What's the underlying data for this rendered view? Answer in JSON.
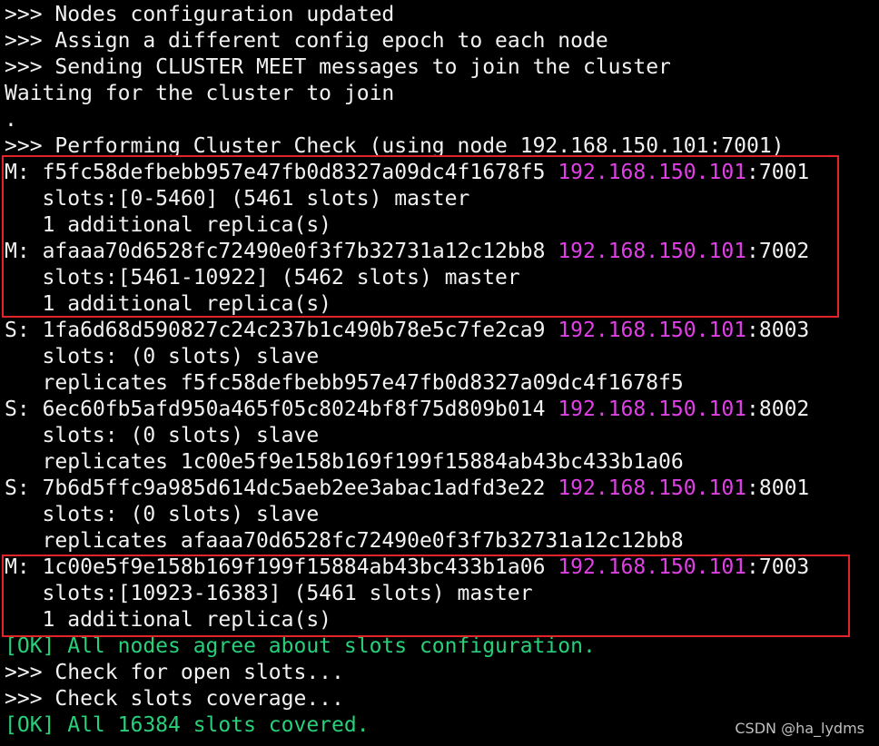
{
  "colors": {
    "background": "#000000",
    "text": "#f2f2f2",
    "ip_address": "#e040e6",
    "ok_message": "#28d07a",
    "highlight_border": "#e0242a"
  },
  "terminal": {
    "lines": [
      ">>> Nodes configuration updated",
      ">>> Assign a different config epoch to each node",
      ">>> Sending CLUSTER MEET messages to join the cluster",
      "Waiting for the cluster to join",
      ".",
      ">>> Performing Cluster Check (using node 192.168.150.101:7001)"
    ],
    "nodes": [
      {
        "role": "M:",
        "id": "f5fc58defbebb957e47fb0d8327a09dc4f1678f5",
        "ip": "192.168.150.101",
        "port": ":7001",
        "slots": "slots:[0-5460] (5461 slots) master",
        "extra": "1 additional replica(s)"
      },
      {
        "role": "M:",
        "id": "afaaa70d6528fc72490e0f3f7b32731a12c12bb8",
        "ip": "192.168.150.101",
        "port": ":7002",
        "slots": "slots:[5461-10922] (5462 slots) master",
        "extra": "1 additional replica(s)"
      },
      {
        "role": "S:",
        "id": "1fa6d68d590827c24c237b1c490b78e5c7fe2ca9",
        "ip": "192.168.150.101",
        "port": ":8003",
        "slots": "slots: (0 slots) slave",
        "extra": "replicates f5fc58defbebb957e47fb0d8327a09dc4f1678f5"
      },
      {
        "role": "S:",
        "id": "6ec60fb5afd950a465f05c8024bf8f75d809b014",
        "ip": "192.168.150.101",
        "port": ":8002",
        "slots": "slots: (0 slots) slave",
        "extra": "replicates 1c00e5f9e158b169f199f15884ab43bc433b1a06"
      },
      {
        "role": "S:",
        "id": "7b6d5ffc9a985d614dc5aeb2ee3abac1adfd3e22",
        "ip": "192.168.150.101",
        "port": ":8001",
        "slots": "slots: (0 slots) slave",
        "extra": "replicates afaaa70d6528fc72490e0f3f7b32731a12c12bb8"
      },
      {
        "role": "M:",
        "id": "1c00e5f9e158b169f199f15884ab43bc433b1a06",
        "ip": "192.168.150.101",
        "port": ":7003",
        "slots": "slots:[10923-16383] (5461 slots) master",
        "extra": "1 additional replica(s)"
      }
    ],
    "ok_slots_config": "[OK] All nodes agree about slots configuration.",
    "check_open_slots": ">>> Check for open slots...",
    "check_slots_coverage": ">>> Check slots coverage...",
    "ok_slots_covered": "[OK] All 16384 slots covered."
  },
  "watermark": "CSDN @ha_lydms"
}
